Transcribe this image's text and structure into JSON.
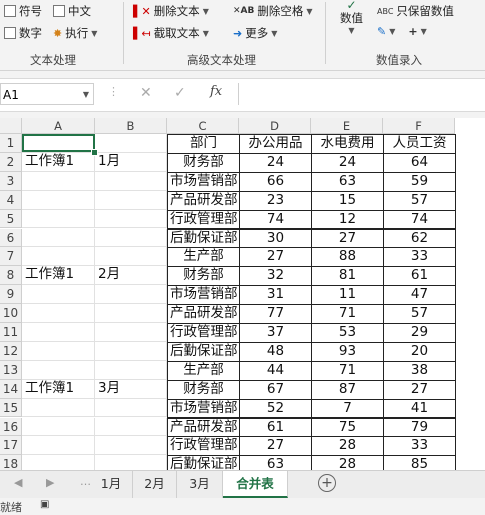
{
  "ribbon": {
    "group1": {
      "items": [
        "符号",
        "中文",
        "数字",
        "执行"
      ],
      "label": "文本处理"
    },
    "group2": {
      "items": [
        "删除文本",
        "删除空格",
        "截取文本",
        "更多"
      ],
      "label": "高级文本处理"
    },
    "group3": {
      "items": [
        "数值",
        "只保留数值"
      ],
      "label": "数值录入"
    }
  },
  "formula_bar": {
    "name_box": "A1",
    "cancel": "✕",
    "enter": "✓",
    "fx": "fx"
  },
  "columns": [
    "A",
    "B",
    "C",
    "D",
    "E",
    "F"
  ],
  "rows": [
    [
      "",
      "",
      "部门",
      "办公用品",
      "水电费用",
      "人员工资"
    ],
    [
      "工作簿1",
      "1月",
      "财务部",
      "24",
      "24",
      "64"
    ],
    [
      "",
      "",
      "市场营销部",
      "66",
      "63",
      "59"
    ],
    [
      "",
      "",
      "产品研发部",
      "23",
      "15",
      "57"
    ],
    [
      "",
      "",
      "行政管理部",
      "74",
      "12",
      "74"
    ],
    [
      "",
      "",
      "后勤保证部",
      "30",
      "27",
      "62"
    ],
    [
      "",
      "",
      "生产部",
      "27",
      "88",
      "33"
    ],
    [
      "工作簿1",
      "2月",
      "财务部",
      "32",
      "81",
      "61"
    ],
    [
      "",
      "",
      "市场营销部",
      "31",
      "11",
      "47"
    ],
    [
      "",
      "",
      "产品研发部",
      "77",
      "71",
      "57"
    ],
    [
      "",
      "",
      "行政管理部",
      "37",
      "53",
      "29"
    ],
    [
      "",
      "",
      "后勤保证部",
      "48",
      "93",
      "20"
    ],
    [
      "",
      "",
      "生产部",
      "44",
      "71",
      "38"
    ],
    [
      "工作簿1",
      "3月",
      "财务部",
      "67",
      "87",
      "27"
    ],
    [
      "",
      "",
      "市场营销部",
      "52",
      "7",
      "41"
    ],
    [
      "",
      "",
      "产品研发部",
      "61",
      "75",
      "79"
    ],
    [
      "",
      "",
      "行政管理部",
      "27",
      "28",
      "33"
    ],
    [
      "",
      "",
      "后勤保证部",
      "63",
      "28",
      "85"
    ]
  ],
  "sheet_tabs": [
    "1月",
    "2月",
    "3月",
    "合并表"
  ],
  "active_tab": "合并表",
  "status": {
    "text": "就绪"
  }
}
